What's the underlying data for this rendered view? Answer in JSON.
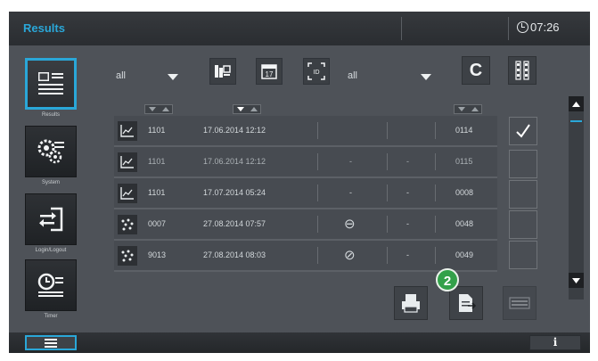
{
  "topbar": {
    "title": "Results",
    "time": "07:26"
  },
  "nav": [
    {
      "label": "Results",
      "icon": "results-list-icon"
    },
    {
      "label": "System",
      "icon": "system-gears-icon"
    },
    {
      "label": "Login/Logout",
      "icon": "login-logout-icon"
    },
    {
      "label": "Timer",
      "icon": "timer-list-icon"
    }
  ],
  "toolbar": {
    "filter1": "all",
    "filter2": "all",
    "clear_label": "C"
  },
  "rows": [
    {
      "kind": "chart",
      "id": "1101",
      "datetime": "17.06.2014 12:12",
      "col_a": "",
      "col_b": "",
      "num": "0114",
      "checked": true
    },
    {
      "kind": "chart",
      "id": "1101",
      "datetime": "17.06.2014 12:12",
      "col_a": "-",
      "col_b": "-",
      "num": "0115",
      "checked": false
    },
    {
      "kind": "chart",
      "id": "1101",
      "datetime": "17.07.2014 05:24",
      "col_a": "-",
      "col_b": "-",
      "num": "0008",
      "checked": false
    },
    {
      "kind": "scatter",
      "id": "0007",
      "datetime": "27.08.2014 07:57",
      "col_a": "⊖",
      "col_b": "-",
      "num": "0048",
      "checked": false
    },
    {
      "kind": "scatter",
      "id": "9013",
      "datetime": "27.08.2014 08:03",
      "col_a": "⊘",
      "col_b": "-",
      "num": "0049",
      "checked": false
    }
  ],
  "actions": {
    "callout_number": "2"
  },
  "bottombar": {
    "info_label": "i"
  }
}
